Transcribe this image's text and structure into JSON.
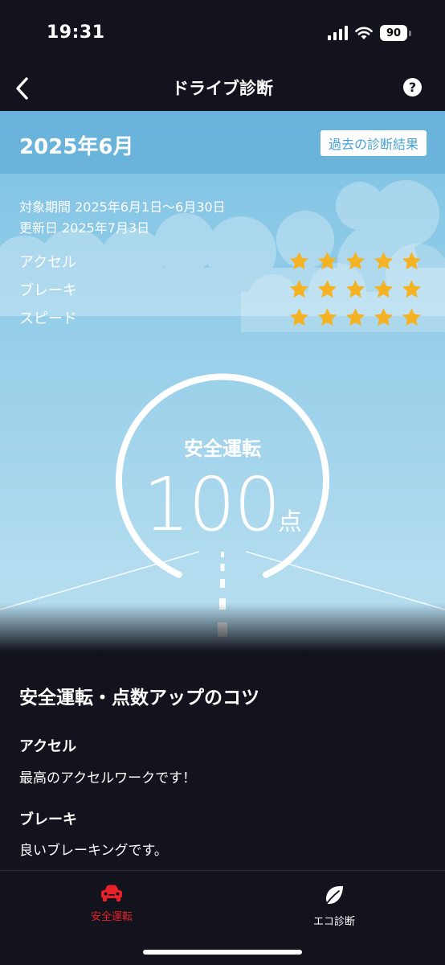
{
  "status_bar": {
    "time": "19:31",
    "battery": "90"
  },
  "nav": {
    "title": "ドライブ診断",
    "help_icon": "question-circle-icon",
    "help_label": "?"
  },
  "header": {
    "month": "2025年6月",
    "history_button": "過去の診断結果"
  },
  "period": {
    "range": "対象期間 2025年6月1日〜6月30日",
    "updated": "更新日 2025年7月3日"
  },
  "ratings": [
    {
      "label": "アクセル",
      "stars": 5,
      "max": 5
    },
    {
      "label": "ブレーキ",
      "stars": 5,
      "max": 5
    },
    {
      "label": "スピード",
      "stars": 5,
      "max": 5
    }
  ],
  "score": {
    "caption": "安全運転",
    "value": "100",
    "unit": "点"
  },
  "tips": {
    "title": "安全運転・点数アップのコツ",
    "items": [
      {
        "heading": "アクセル",
        "text": "最高のアクセルワークです！"
      },
      {
        "heading": "ブレーキ",
        "text": "良いブレーキングです。"
      }
    ]
  },
  "tabs": [
    {
      "label": "安全運転",
      "icon": "car-icon",
      "active": true
    },
    {
      "label": "エコ診断",
      "icon": "leaf-icon",
      "active": false
    }
  ],
  "colors": {
    "star": "#f5b324",
    "active_tab": "#e8202a",
    "sky": "#8fcbe8",
    "background": "#12131c"
  }
}
